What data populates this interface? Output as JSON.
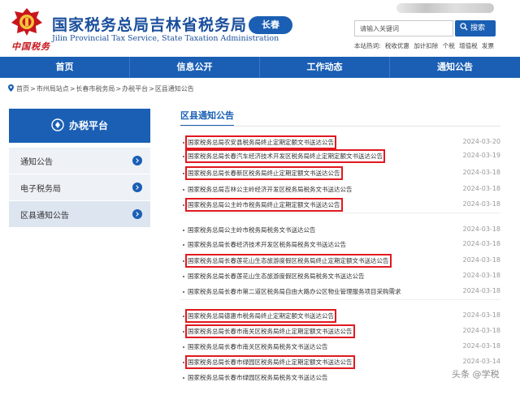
{
  "header": {
    "site_title": "国家税务总局吉林省税务局",
    "site_subtitle": "Jilin Provincial Tax Service, State Taxation Administration",
    "brand_script": "中国税务",
    "city_badge": "长春",
    "search": {
      "placeholder": "请输入关键词",
      "button_label": "搜索"
    },
    "hot_words_label": "本站热词:",
    "hot_words": [
      "税收优惠",
      "加计扣除",
      "个税",
      "增值税",
      "发票"
    ]
  },
  "nav": {
    "items": [
      "首页",
      "信息公开",
      "工作动态",
      "通知公告"
    ]
  },
  "breadcrumb": [
    "首页",
    "市州局站点",
    "长春市税务局",
    "办税平台",
    "区县通知公告"
  ],
  "sidebar": {
    "heading": "办税平台",
    "items": [
      {
        "label": "通知公告"
      },
      {
        "label": "电子税务局"
      },
      {
        "label": "区县通知公告"
      }
    ]
  },
  "main": {
    "section_title": "区县通知公告",
    "rows": [
      {
        "title": "国家税务总局农安县税务局终止定期定额文书送达公告",
        "date": "2024-03-20",
        "highlighted": true
      },
      {
        "title": "国家税务总局长春汽车经济技术开发区税务局终止定期定额文书送达公告",
        "date": "2024-03-19",
        "highlighted": true
      },
      {
        "title": "国家税务总局长春新区税务局终止定期定额文书送达公告",
        "date": "2024-03-18",
        "highlighted": true
      },
      {
        "title": "国家税务总局吉林公主岭经济开发区税务局税务文书送达公告",
        "date": "2024-03-18",
        "highlighted": false
      },
      {
        "title": "国家税务总局公主岭市税务局终止定期定额文书送达公告",
        "date": "2024-03-18",
        "highlighted": true
      },
      {
        "title": "国家税务总局公主岭市税务局税务文书送达公告",
        "date": "2024-03-18",
        "highlighted": false
      },
      {
        "title": "国家税务总局长春经济技术开发区税务局税务文书送达公告",
        "date": "2024-03-18",
        "highlighted": false
      },
      {
        "title": "国家税务总局长春莲花山生态旅游度假区税务局终止定期定额文书送达公告",
        "date": "2024-03-18",
        "highlighted": true
      },
      {
        "title": "国家税务总局长春莲花山生态旅游度假区税务局税务文书送达公告",
        "date": "2024-03-18",
        "highlighted": false
      },
      {
        "title": "国家税务总局长春市第二道区税务局自由大路办公区物业管理服务项目采购需求",
        "date": "2024-03-18",
        "highlighted": false
      },
      {
        "title": "国家税务总局德惠市税务局终止定期定额文书送达公告",
        "date": "2024-03-18",
        "highlighted": true
      },
      {
        "title": "国家税务总局长春市南关区税务局终止定期定额文书送达公告",
        "date": "2024-03-18",
        "highlighted": true
      },
      {
        "title": "国家税务总局长春市南关区税务局税务文书送达公告",
        "date": "2024-03-18",
        "highlighted": false
      },
      {
        "title": "国家税务总局长春市绿园区税务局终止定期定额文书送达公告",
        "date": "2024-03-14",
        "highlighted": true
      },
      {
        "title": "国家税务总局长春市绿园区税务局税务文书送达公告",
        "date": "",
        "highlighted": false
      }
    ]
  },
  "watermark": "头条 @学税",
  "colors": {
    "primary": "#1a5fb4",
    "highlight_box": "#e0191f",
    "emblem_red": "#c8161d"
  }
}
